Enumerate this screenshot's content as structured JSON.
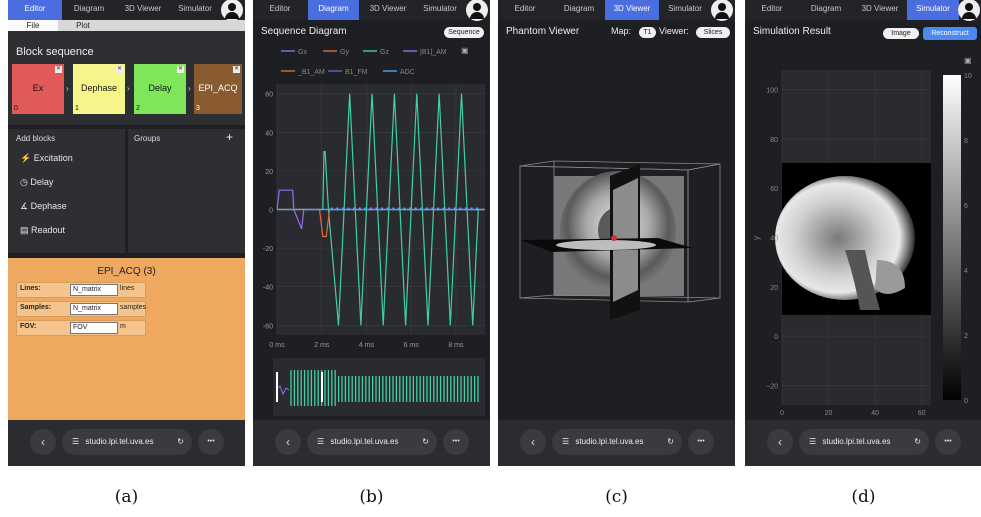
{
  "browser": {
    "url": "studio.lpi.tel.uva.es",
    "back": "‹",
    "reload": "↻",
    "more": "•••"
  },
  "tabs": [
    "Editor",
    "Diagram",
    "3D Viewer",
    "Simulator"
  ],
  "captions": [
    "(a)",
    "(b)",
    "(c)",
    "(d)"
  ],
  "panel_a": {
    "menu": [
      "File",
      "Plot"
    ],
    "block_sequence_title": "Block sequence",
    "blocks": [
      {
        "name": "Ex",
        "index": "0",
        "color": "#e05a58"
      },
      {
        "name": "Dephase",
        "index": "1",
        "color": "#f5f58a"
      },
      {
        "name": "Delay",
        "index": "2",
        "color": "#7fe65a"
      },
      {
        "name": "EPI_ACQ",
        "index": "3",
        "color": "#8a5a30"
      }
    ],
    "close_glyph": "✕",
    "chevron": "›",
    "add_blocks_title": "Add blocks",
    "add_blocks": [
      "Excitation",
      "Delay",
      "Dephase",
      "Readout"
    ],
    "groups_title": "Groups",
    "plus": "+",
    "editor": {
      "title": "EPI_ACQ (3)",
      "fields": [
        {
          "label": "Lines:",
          "value": "N_matrix",
          "unit": "lines"
        },
        {
          "label": "Samples:",
          "value": "N_matrix",
          "unit": "samples"
        },
        {
          "label": "FOV:",
          "value": "FOV",
          "unit": "m"
        }
      ]
    }
  },
  "panel_b": {
    "title": "Sequence Diagram",
    "dropdown": "Sequence",
    "legend": [
      "Gx",
      "Gy",
      "Gz",
      "|B1|_AM",
      "_B1_AM",
      "B1_FM",
      "ADC"
    ],
    "chart_data": {
      "type": "line",
      "x_ticks": [
        "0 ms",
        "2 ms",
        "4 ms",
        "6 ms",
        "8 ms"
      ],
      "y_ticks": [
        "60",
        "40",
        "20",
        "0",
        "-20",
        "-40",
        "-60"
      ],
      "ylim": [
        -65,
        65
      ],
      "xlim": [
        0,
        9.3
      ],
      "series": [
        {
          "name": "Gz",
          "color": "#3fd1a0",
          "x": [
            0.0,
            1.1,
            1.4,
            1.9,
            2.05,
            2.1,
            2.15,
            2.3,
            2.75,
            3.25,
            3.75,
            4.25,
            4.75,
            5.25,
            5.75,
            6.25,
            6.75,
            7.25,
            7.75,
            8.25,
            8.75,
            9.0,
            9.3
          ],
          "y": [
            0,
            0,
            0,
            0,
            0,
            30,
            30,
            0,
            -60,
            60,
            -60,
            60,
            -60,
            60,
            -60,
            60,
            -60,
            60,
            -60,
            60,
            -60,
            0,
            0
          ]
        },
        {
          "name": "Gy",
          "color": "#e06a3c",
          "x": [
            0,
            1.9,
            2.05,
            2.2,
            2.35,
            9.3
          ],
          "y": [
            0,
            0,
            -14,
            -14,
            0,
            0
          ]
        },
        {
          "name": "|B1|_AM",
          "color": "#9a6cf0",
          "x": [
            0,
            0.1,
            0.7,
            0.75,
            1.1,
            1.2,
            9.3
          ],
          "y": [
            0,
            10,
            10,
            0,
            -10,
            0,
            0
          ]
        },
        {
          "name": "ADC",
          "color": "#4aa8f0",
          "x": [
            0,
            2.35,
            2.35,
            9.3
          ],
          "y": [
            0,
            0,
            0,
            0
          ]
        }
      ]
    }
  },
  "panel_c": {
    "title": "Phantom Viewer",
    "map_label": "Map:",
    "map_value": "T1",
    "viewer_label": "Viewer:",
    "viewer_value": "Slices"
  },
  "panel_d": {
    "title": "Simulation Result",
    "dropdown": "Image",
    "button": "Reconstruct",
    "chart_data": {
      "type": "heatmap",
      "ylabel": "y",
      "x_ticks": [
        "0",
        "20",
        "40",
        "60"
      ],
      "y_ticks": [
        "100",
        "80",
        "60",
        "40",
        "20",
        "0",
        "−20"
      ],
      "colorbar_ticks": [
        "10",
        "8",
        "6",
        "4",
        "2",
        "0"
      ],
      "xlim": [
        0,
        64
      ],
      "ylim": [
        -28,
        108
      ],
      "colorbar_range": [
        0,
        10
      ]
    }
  }
}
